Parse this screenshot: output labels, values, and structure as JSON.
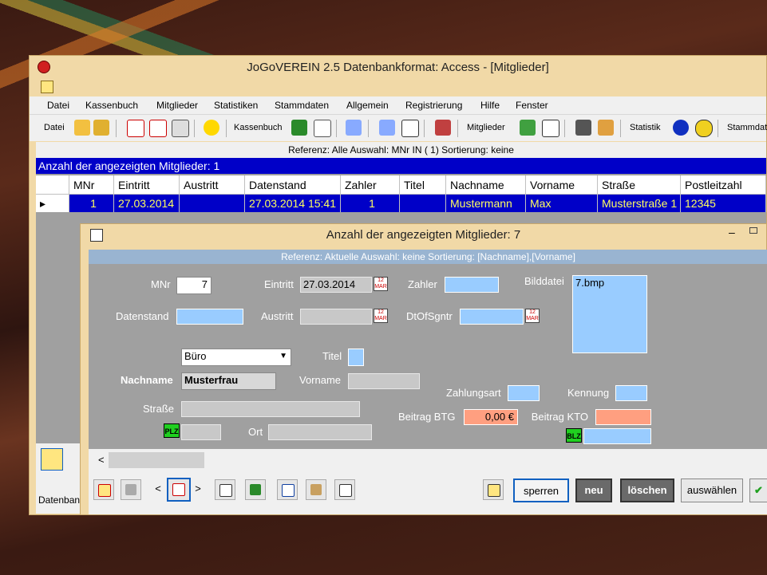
{
  "main": {
    "title": "JoGoVEREIN 2.5 Datenbankformat: Access - [Mitglieder]",
    "menu": [
      "Datei",
      "Kassenbuch",
      "Mitglieder",
      "Statistiken",
      "Stammdaten",
      "Allgemein",
      "Registrierung",
      "Hilfe",
      "Fenster"
    ],
    "toolbar_labels": {
      "datei": "Datei",
      "kassenbuch": "Kassenbuch",
      "mitglieder": "Mitglieder",
      "statistik": "Statistik",
      "stammdaten": "Stammdaten"
    },
    "reference": "Referenz: Alle  Auswahl: MNr IN ( 1)  Sortierung: keine",
    "count": "Anzahl der angezeigten Mitglieder: 1",
    "columns": [
      "MNr",
      "Eintritt",
      "Austritt",
      "Datenstand",
      "Zahler",
      "Titel",
      "Nachname",
      "Vorname",
      "Straße",
      "Postleitzahl"
    ],
    "row": [
      "1",
      "27.03.2014",
      "",
      "27.03.2014 15:41",
      "1",
      "",
      "Mustermann",
      "Max",
      "Musterstraße 1",
      "12345"
    ],
    "status": "Datenban"
  },
  "child": {
    "title": "Anzahl der angezeigten Mitglieder: 7",
    "reference": "Referenz: Aktuelle  Auswahl: keine  Sortierung: [Nachname],[Vorname]",
    "labels": {
      "mnr": "MNr",
      "eintritt": "Eintritt",
      "zahler": "Zahler",
      "bilddatei": "Bilddatei",
      "datenstand": "Datenstand",
      "austritt": "Austritt",
      "dtofsgntr": "DtOfSgntr",
      "titel": "Titel",
      "nachname": "Nachname",
      "vorname": "Vorname",
      "strasse": "Straße",
      "ort": "Ort",
      "zahlungsart": "Zahlungsart",
      "kennung": "Kennung",
      "beitrag_btg": "Beitrag BTG",
      "beitrag_kto": "Beitrag KTO"
    },
    "values": {
      "mnr": "7",
      "eintritt": "27.03.2014",
      "bilddatei": "7.bmp",
      "anrede": "Büro",
      "nachname": "Musterfrau",
      "beitrag_btg": "0,00 €"
    },
    "badges": {
      "plz": "PLZ",
      "blz": "BLZ"
    },
    "buttons": {
      "sperren": "sperren",
      "neu": "neu",
      "loeschen": "löschen",
      "auswaehlen": "auswählen"
    },
    "nav": {
      "prev": "<",
      "next": ">",
      "scroll_left": "<"
    }
  },
  "colors": {
    "selection": "#0000c8",
    "field_blue": "#99ccff",
    "salmon": "#ff9f80",
    "window": "#f1d9a7"
  }
}
